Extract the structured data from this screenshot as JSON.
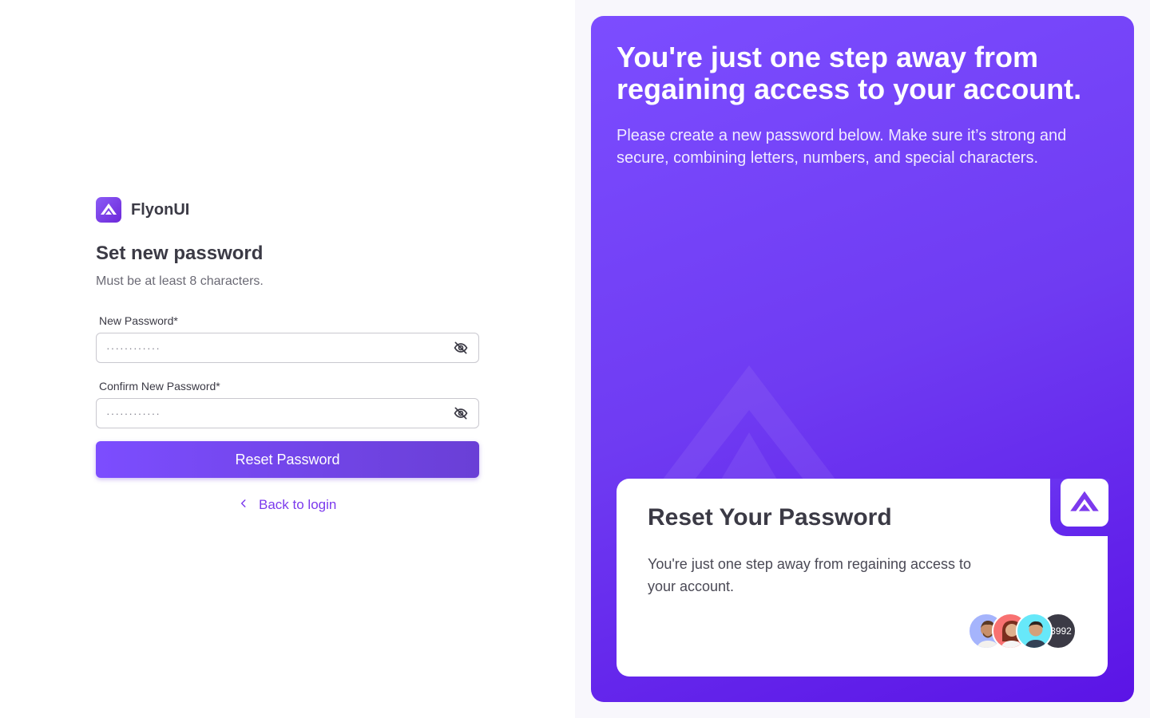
{
  "brand": {
    "name": "FlyonUI"
  },
  "form": {
    "title": "Set new password",
    "subtitle": "Must be at least 8 characters.",
    "new_password": {
      "label": "New Password*",
      "placeholder": "············"
    },
    "confirm_password": {
      "label": "Confirm New Password*",
      "placeholder": "············"
    },
    "submit_label": "Reset Password",
    "back_label": "Back to login"
  },
  "hero": {
    "title": "You're just one step away from regaining access to your account.",
    "subtitle": "Please create a new password below. Make sure it’s strong and secure, combining letters, numbers, and special characters."
  },
  "card": {
    "title": "Reset Your Password",
    "text": "You're just one step away from regaining access to your account.",
    "avatar_count": "+3992"
  },
  "colors": {
    "accent": "#7c3aed",
    "hero_start": "#7c4dff",
    "hero_end": "#5b14e6"
  },
  "icons": [
    "flyonui-logo-icon",
    "eye-off-icon",
    "chevron-left-icon"
  ]
}
